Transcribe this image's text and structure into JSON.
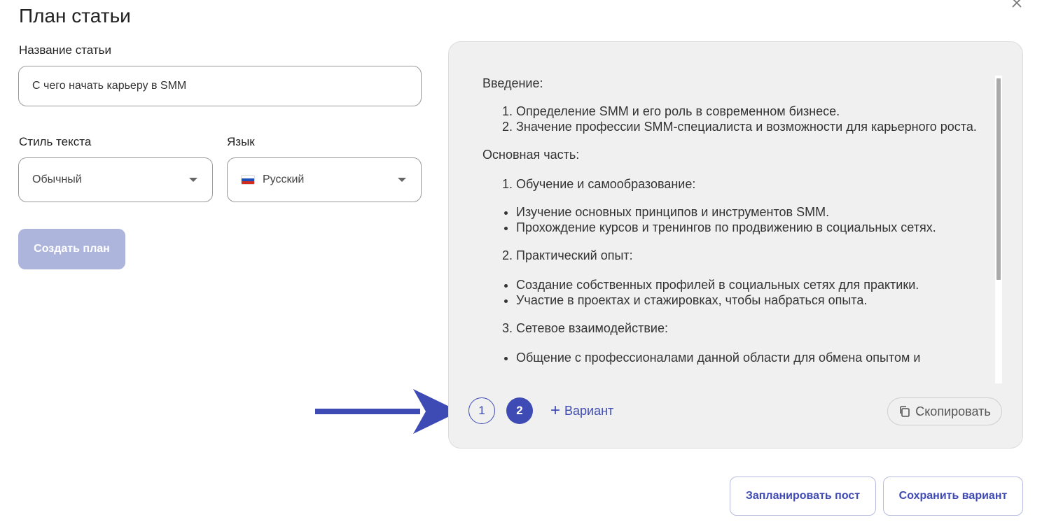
{
  "header": {
    "title": "План статьи"
  },
  "form": {
    "title_label": "Название статьи",
    "title_value": "С чего начать карьеру в SMM",
    "style_label": "Стиль текста",
    "style_value": "Обычный",
    "language_label": "Язык",
    "language_value": "Русский",
    "create_button_label": "Создать план"
  },
  "result": {
    "intro_heading": "Введение:",
    "intro_items": [
      "Определение SMM и его роль в современном бизнесе.",
      "Значение профессии SMM-специалиста и возможности для карьерного роста."
    ],
    "main_heading": "Основная часть:",
    "sections": [
      {
        "title": "Обучение и самообразование:",
        "bullets": [
          "Изучение основных принципов и инструментов SMM.",
          "Прохождение курсов и тренингов по продвижению в социальных сетях."
        ]
      },
      {
        "title": "Практический опыт:",
        "bullets": [
          "Создание собственных профилей в социальных сетях для практики.",
          "Участие в проектах и стажировках, чтобы набраться опыта."
        ]
      },
      {
        "title": "Сетевое взаимодействие:",
        "bullets": [
          "Общение с профессионалами данной области для обмена опытом и"
        ]
      }
    ]
  },
  "variants": {
    "items": [
      "1",
      "2"
    ],
    "selected": "2",
    "add_label": "Вариант"
  },
  "actions": {
    "copy_label": "Скопировать",
    "schedule_label": "Запланировать пост",
    "save_label": "Сохранить вариант"
  },
  "colors": {
    "accent": "#3f4bb5",
    "disabled_button": "#aeb5dd",
    "panel_bg": "#f0f0f0"
  }
}
